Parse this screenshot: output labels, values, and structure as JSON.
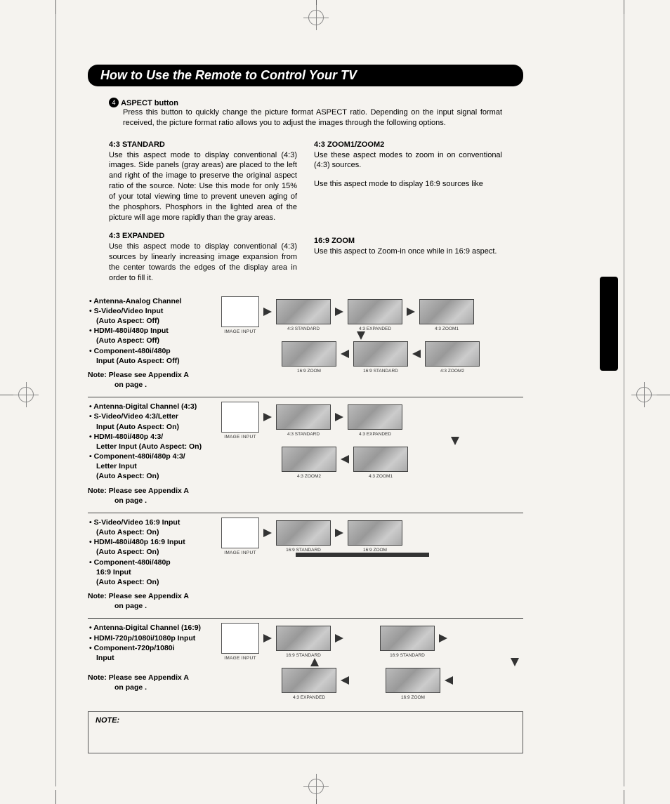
{
  "header": {
    "title": "How to Use the Remote to Control Your TV"
  },
  "item": {
    "num": "4",
    "name": "ASPECT button",
    "desc": "Press this button to quickly change the picture format ASPECT ratio. Depending on the input signal format received, the picture format ratio allows you to adjust the images through the following options."
  },
  "modes": {
    "std": {
      "h": "4:3 STANDARD",
      "p": "Use this aspect mode to display conventional (4:3) images. Side panels (gray areas) are placed to the left and right of the image to preserve the original aspect ratio of the source.  Note: Use this mode for only 15% of your total viewing time to prevent uneven aging of the phosphors.  Phosphors in the lighted area of the picture will age more rapidly than the gray areas."
    },
    "exp": {
      "h": "4:3 EXPANDED",
      "p": "Use this aspect mode to display conventional (4:3) sources by linearly increasing image expansion from the center towards the edges of the display area in order to fill it."
    },
    "zoom43": {
      "h": "4:3 ZOOM1/ZOOM2",
      "p": "Use these aspect modes to zoom in on conventional (4:3) sources.",
      "p2": "Use this aspect mode to display 16:9 sources like"
    },
    "zoom169": {
      "h": "16:9 ZOOM",
      "p": "Use this aspect to Zoom-in once while in 16:9 aspect."
    }
  },
  "labels": {
    "image_input": "IMAGE INPUT",
    "std43": "4:3 STANDARD",
    "exp43": "4:3 EXPANDED",
    "zoom1_43": "4:3 ZOOM1",
    "zoom2_43": "4:3 ZOOM2",
    "zoom169": "16:9 ZOOM",
    "std169": "16:9 STANDARD"
  },
  "groups": {
    "g1": {
      "b1": "• Antenna-Analog Channel",
      "b2": "• S-Video/Video Input",
      "b2s": "(Auto Aspect: Off)",
      "b3": "• HDMI-480i/480p Input",
      "b3s": "(Auto Aspect: Off)",
      "b4": "• Component-480i/480p",
      "b4s": "Input (Auto Aspect: Off)",
      "note": "Note:  Please see Appendix A",
      "note2": "on page         ."
    },
    "g2": {
      "b1": "• Antenna-Digital Channel (4:3)",
      "b2": "• S-Video/Video 4:3/Letter",
      "b2s": "Input (Auto Aspect: On)",
      "b3": "• HDMI-480i/480p 4:3/",
      "b3s": "Letter Input (Auto Aspect: On)",
      "b4": "• Component-480i/480p 4:3/",
      "b4s": "Letter Input",
      "b4t": "(Auto Aspect: On)",
      "note": "Note:  Please see Appendix A",
      "note2": "on page         ."
    },
    "g3": {
      "b1": "• S-Video/Video 16:9 Input",
      "b1s": "(Auto Aspect: On)",
      "b2": "• HDMI-480i/480p 16:9 Input",
      "b2s": "(Auto Aspect: On)",
      "b3": "• Component-480i/480p",
      "b3s": "16:9 Input",
      "b3t": "(Auto Aspect: On)",
      "note": "Note:  Please see Appendix A",
      "note2": "on page         ."
    },
    "g4": {
      "b1": "• Antenna-Digital Channel (16:9)",
      "b2": "• HDMI-720p/1080i/1080p Input",
      "b3": "• Component-720p/1080i",
      "b3s": "Input",
      "note": "Note:  Please see Appendix A",
      "note2": "on page         ."
    }
  },
  "notebox": {
    "label": "NOTE:"
  }
}
